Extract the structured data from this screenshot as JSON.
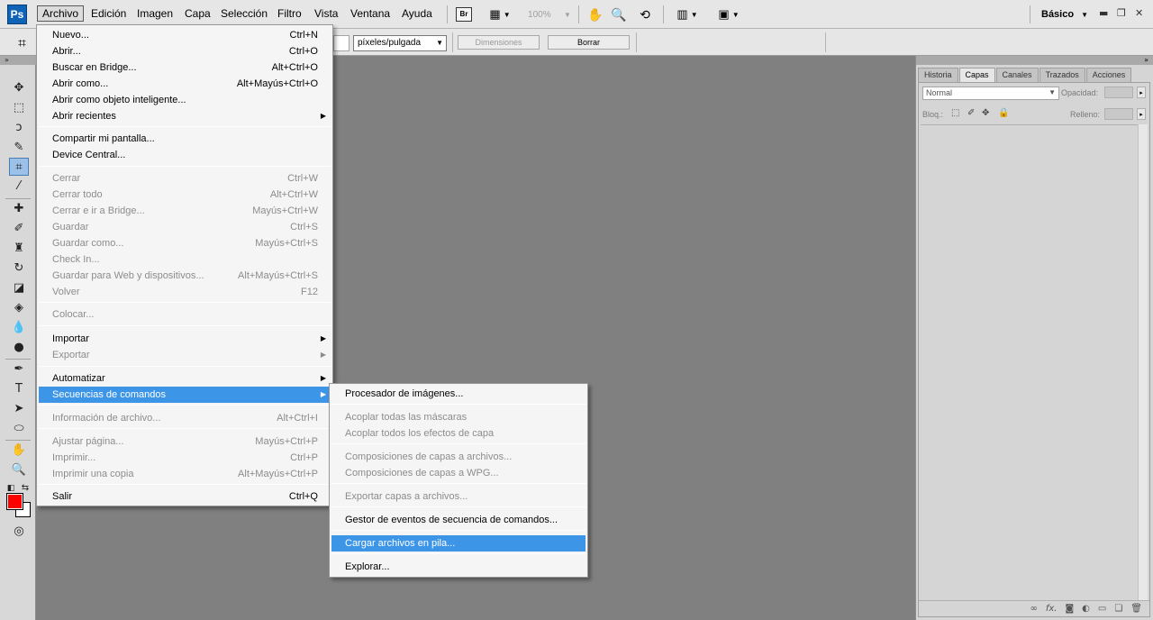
{
  "app": {
    "logo": "Ps",
    "workspace": "Básico",
    "zoom": "100%"
  },
  "menubar": [
    "Archivo",
    "Edición",
    "Imagen",
    "Capa",
    "Selección",
    "Filtro",
    "Vista",
    "Ventana",
    "Ayuda"
  ],
  "menubar_icons": {
    "bridge": "Br"
  },
  "options": {
    "units": "píxeles/pulgada",
    "dimensions_button": "Dimensiones",
    "clear_button": "Borrar"
  },
  "file_menu": [
    {
      "label": "Nuevo...",
      "shortcut": "Ctrl+N"
    },
    {
      "label": "Abrir...",
      "shortcut": "Ctrl+O"
    },
    {
      "label": "Buscar en Bridge...",
      "shortcut": "Alt+Ctrl+O"
    },
    {
      "label": "Abrir como...",
      "shortcut": "Alt+Mayús+Ctrl+O"
    },
    {
      "label": "Abrir como objeto inteligente...",
      "shortcut": ""
    },
    {
      "label": "Abrir recientes",
      "shortcut": ""
    },
    {
      "label": "Compartir mi pantalla...",
      "shortcut": ""
    },
    {
      "label": "Device Central...",
      "shortcut": ""
    },
    {
      "label": "Cerrar",
      "shortcut": "Ctrl+W"
    },
    {
      "label": "Cerrar todo",
      "shortcut": "Alt+Ctrl+W"
    },
    {
      "label": "Cerrar e ir a Bridge...",
      "shortcut": "Mayús+Ctrl+W"
    },
    {
      "label": "Guardar",
      "shortcut": "Ctrl+S"
    },
    {
      "label": "Guardar como...",
      "shortcut": "Mayús+Ctrl+S"
    },
    {
      "label": "Check In...",
      "shortcut": ""
    },
    {
      "label": "Guardar para Web y dispositivos...",
      "shortcut": "Alt+Mayús+Ctrl+S"
    },
    {
      "label": "Volver",
      "shortcut": "F12"
    },
    {
      "label": "Colocar...",
      "shortcut": ""
    },
    {
      "label": "Importar",
      "shortcut": ""
    },
    {
      "label": "Exportar",
      "shortcut": ""
    },
    {
      "label": "Automatizar",
      "shortcut": ""
    },
    {
      "label": "Secuencias de comandos",
      "shortcut": ""
    },
    {
      "label": "Información de archivo...",
      "shortcut": "Alt+Ctrl+I"
    },
    {
      "label": "Ajustar página...",
      "shortcut": "Mayús+Ctrl+P"
    },
    {
      "label": "Imprimir...",
      "shortcut": "Ctrl+P"
    },
    {
      "label": "Imprimir una copia",
      "shortcut": "Alt+Mayús+Ctrl+P"
    },
    {
      "label": "Salir",
      "shortcut": "Ctrl+Q"
    }
  ],
  "scripts_menu": [
    "Procesador de imágenes...",
    "Acoplar todas las máscaras",
    "Acoplar todos los efectos de capa",
    "Composiciones de capas a archivos...",
    "Composiciones de capas a WPG...",
    "Exportar capas a archivos...",
    "Gestor de eventos de secuencia de comandos...",
    "Cargar archivos en pila...",
    "Explorar..."
  ],
  "panel": {
    "tabs": [
      "Historia",
      "Capas",
      "Canales",
      "Trazados",
      "Acciones"
    ],
    "blend_mode": "Normal",
    "opacity_label": "Opacidad:",
    "lock_label": "Bloq.:",
    "fill_label": "Relleno:"
  },
  "colors": {
    "foreground": "#ff0000",
    "background": "#ffffff",
    "highlight": "#3d95e8",
    "canvas": "#808080"
  }
}
